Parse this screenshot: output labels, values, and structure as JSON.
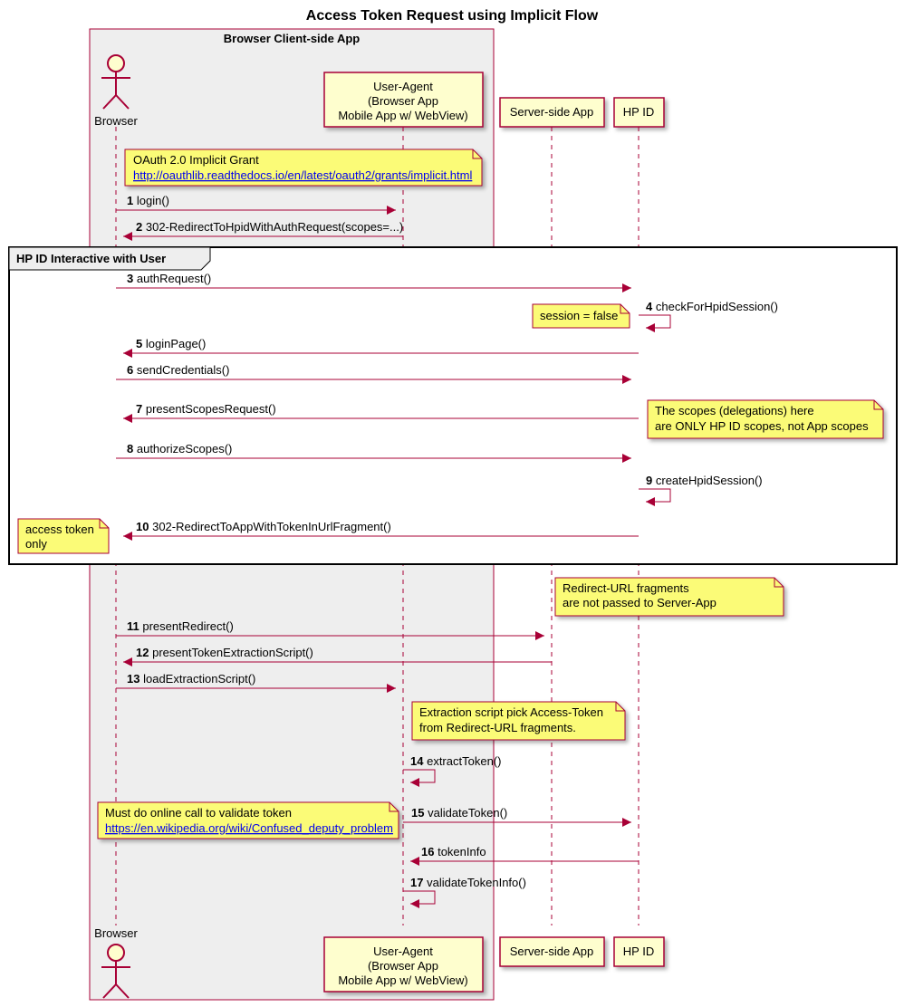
{
  "title": "Access Token Request using Implicit Flow",
  "group": {
    "label": "Browser Client-side App"
  },
  "frame": {
    "label": "HP ID Interactive with User"
  },
  "actors": {
    "browser": {
      "label": "Browser"
    }
  },
  "participants": {
    "ua": {
      "line1": "User-Agent",
      "line2": "(Browser App",
      "line3": "Mobile App w/ WebView)"
    },
    "server": {
      "label": "Server-side App"
    },
    "hpid": {
      "label": "HP ID"
    }
  },
  "notes": {
    "oauth": {
      "line1": "OAuth 2.0 Implicit Grant",
      "link": "http://oauthlib.readthedocs.io/en/latest/oauth2/grants/implicit.html"
    },
    "session": {
      "text": "session = false"
    },
    "scopes": {
      "line1": "The scopes (delegations) here",
      "line2": "are ONLY HP ID scopes, not App scopes"
    },
    "token": {
      "line1": "access token",
      "line2": "only"
    },
    "redirect": {
      "line1": "Redirect-URL fragments",
      "line2": "are not passed to Server-App"
    },
    "extract": {
      "line1": "Extraction script pick Access-Token",
      "line2": "from Redirect-URL fragments."
    },
    "validate": {
      "line1": "Must do online call to validate token",
      "link": "https://en.wikipedia.org/wiki/Confused_deputy_problem"
    }
  },
  "messages": {
    "m1": {
      "num": "1",
      "text": "login()"
    },
    "m2": {
      "num": "2",
      "text": "302-RedirectToHpidWithAuthRequest(scopes=...)"
    },
    "m3": {
      "num": "3",
      "text": "authRequest()"
    },
    "m4": {
      "num": "4",
      "text": "checkForHpidSession()"
    },
    "m5": {
      "num": "5",
      "text": "loginPage()"
    },
    "m6": {
      "num": "6",
      "text": "sendCredentials()"
    },
    "m7": {
      "num": "7",
      "text": "presentScopesRequest()"
    },
    "m8": {
      "num": "8",
      "text": "authorizeScopes()"
    },
    "m9": {
      "num": "9",
      "text": "createHpidSession()"
    },
    "m10": {
      "num": "10",
      "text": "302-RedirectToAppWithTokenInUrlFragment()"
    },
    "m11": {
      "num": "11",
      "text": "presentRedirect()"
    },
    "m12": {
      "num": "12",
      "text": "presentTokenExtractionScript()"
    },
    "m13": {
      "num": "13",
      "text": "loadExtractionScript()"
    },
    "m14": {
      "num": "14",
      "text": "extractToken()"
    },
    "m15": {
      "num": "15",
      "text": "validateToken()"
    },
    "m16": {
      "num": "16",
      "text": "tokenInfo"
    },
    "m17": {
      "num": "17",
      "text": "validateTokenInfo()"
    }
  }
}
